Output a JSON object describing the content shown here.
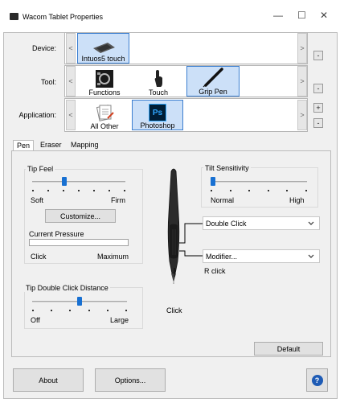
{
  "window": {
    "title": "Wacom Tablet Properties",
    "minimize": "—",
    "maximize": "☐",
    "close": "✕"
  },
  "device_row": {
    "label": "Device:",
    "items": [
      {
        "label": "Intuos5 touch",
        "icon": "tablet-icon",
        "selected": true
      }
    ]
  },
  "tool_row": {
    "label": "Tool:",
    "items": [
      {
        "label": "Functions",
        "icon": "functions-icon",
        "selected": false
      },
      {
        "label": "Touch",
        "icon": "hand-icon",
        "selected": false
      },
      {
        "label": "Grip Pen",
        "icon": "pen-icon",
        "selected": true
      }
    ]
  },
  "application_row": {
    "label": "Application:",
    "items": [
      {
        "label": "All Other",
        "icon": "all-other-apps-icon",
        "selected": false
      },
      {
        "label": "Photoshop",
        "icon": "photoshop-icon",
        "icon_text": "Ps",
        "selected": true
      }
    ]
  },
  "nav": {
    "left": "<",
    "right": ">",
    "add": "+",
    "remove": "-"
  },
  "tabs": [
    {
      "label": "Pen",
      "active": true
    },
    {
      "label": "Eraser",
      "active": false
    },
    {
      "label": "Mapping",
      "active": false
    }
  ],
  "tip_feel": {
    "title": "Tip Feel",
    "min_label": "Soft",
    "max_label": "Firm",
    "tick_count": 7,
    "level_fraction": 0.34,
    "customize_label": "Customize..."
  },
  "pressure": {
    "title": "Current Pressure",
    "min_label": "Click",
    "max_label": "Maximum",
    "level_fraction": 0
  },
  "double_click": {
    "title": "Tip Double Click Distance",
    "min_label": "Off",
    "max_label": "Large",
    "tick_count": 6,
    "level_fraction": 0.5
  },
  "tilt": {
    "title": "Tilt Sensitivity",
    "min_label": "Normal",
    "max_label": "High",
    "tick_count": 6,
    "level_fraction": 0.0
  },
  "pen": {
    "upper_button": "Double Click",
    "lower_button": "Modifier...",
    "lower_button_sub": "R click",
    "tip_label": "Click"
  },
  "default_label": "Default",
  "footer": {
    "about_label": "About",
    "options_label": "Options...",
    "help_label": "?"
  },
  "colors": {
    "accent": "#1870d2",
    "selection": "#cce0f8",
    "help_button": "#1e5bb5",
    "photoshop": "#001e36"
  }
}
